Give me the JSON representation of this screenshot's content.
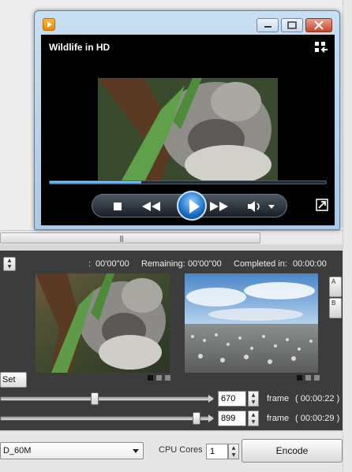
{
  "player": {
    "title": "Wildlife in HD",
    "seek_progress": 0.33,
    "icons": [
      "app-icon",
      "minimize-icon",
      "maximize-icon",
      "close-icon",
      "switch-to-library-icon",
      "stop-icon",
      "rewind-icon",
      "play-icon",
      "fast-forward-icon",
      "volume-icon",
      "volume-dropdown-icon",
      "fullscreen-icon"
    ]
  },
  "encoder": {
    "start_time_prefix": ":",
    "start_time": "00'00\"00",
    "remaining_label": "Remaining:",
    "remaining_value": "00'00\"00",
    "completed_label": "Completed in:",
    "completed_value": "00:00:00",
    "marker_a_label": "A",
    "marker_b_label": "B",
    "set_button": "Set",
    "slider_a": {
      "value": "670",
      "unit": "frame",
      "time": "( 00:00:22 )",
      "position": 0.44
    },
    "slider_b": {
      "value": "899",
      "unit": "frame",
      "time": "( 00:00:29 )",
      "position": 0.93
    },
    "profile": "D_60M",
    "cpu_label": "CPU Cores",
    "cpu_value": "1",
    "encode_button": "Encode"
  },
  "colors": {
    "panel_bg": "#3c3c3c",
    "player_frame": "#b8d4ee",
    "play_button": "#1a6ec6"
  }
}
